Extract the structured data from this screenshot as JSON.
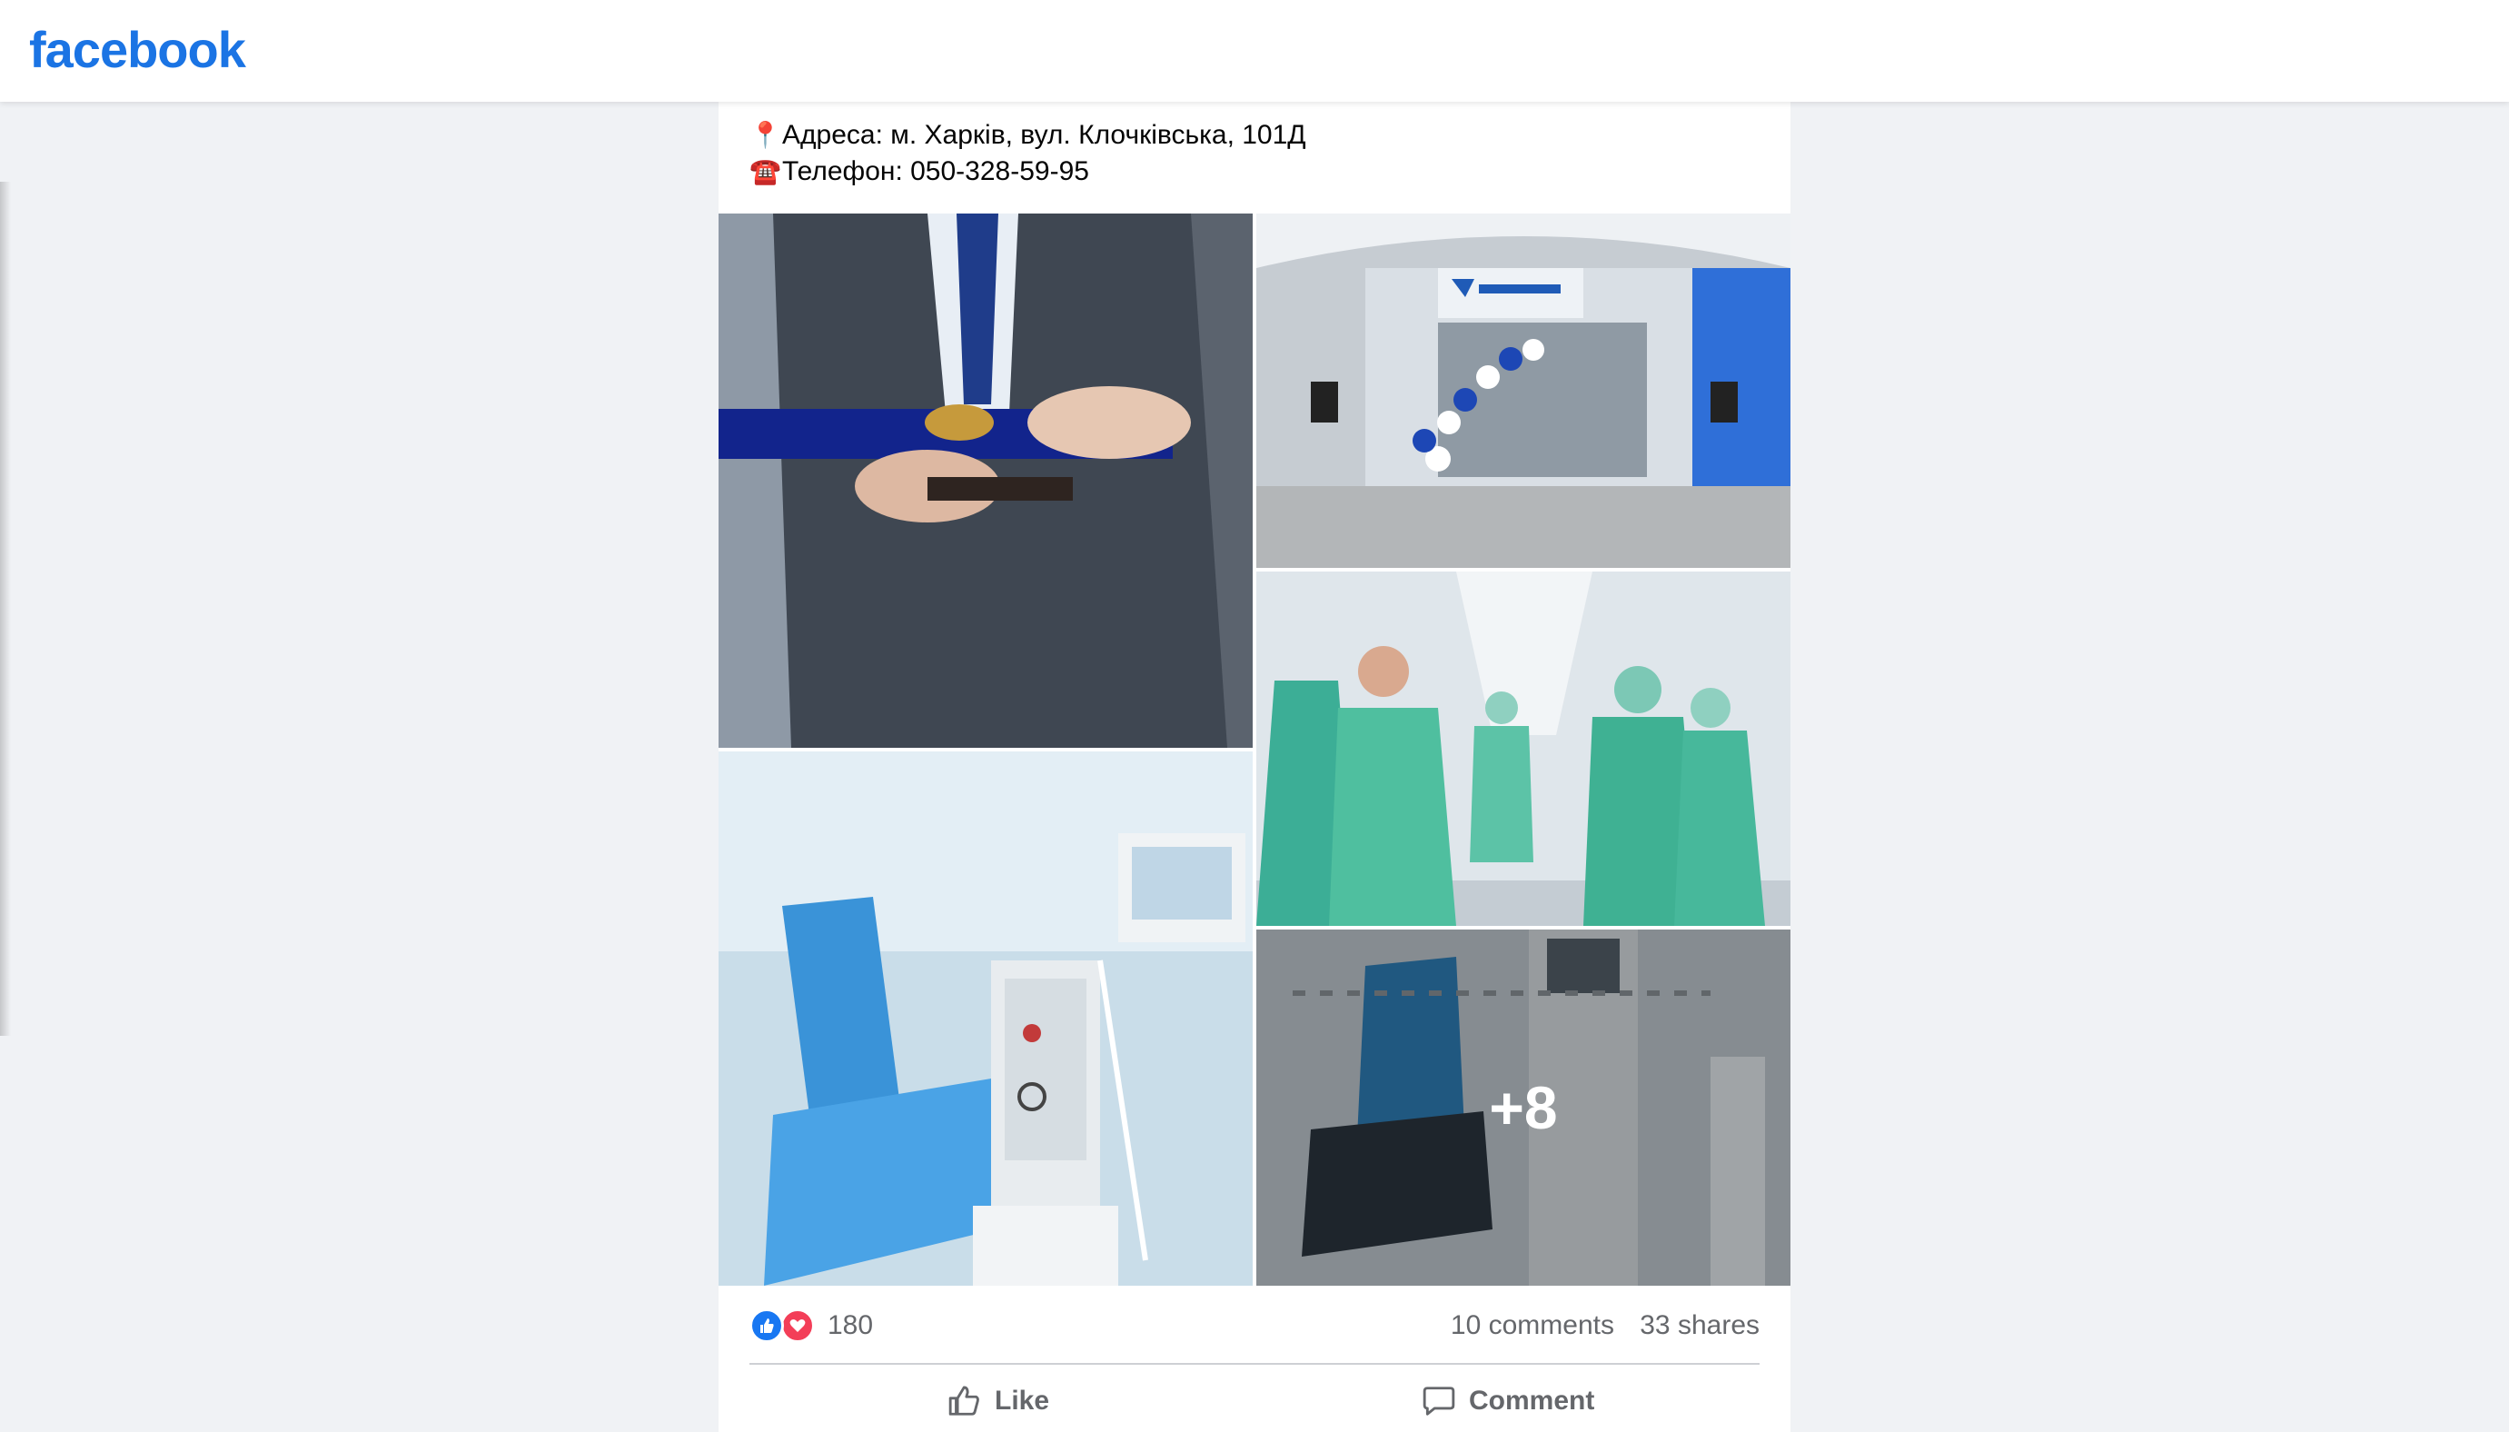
{
  "header": {
    "logo": "facebook"
  },
  "post": {
    "text_lines": [
      {
        "emoji": "📍",
        "text": "Адреса: м. Харків, вул. Клочківська, 101Д"
      },
      {
        "emoji": "☎️",
        "text": "Телефон: 050-328-59-95"
      }
    ],
    "photos": [
      {
        "name": "photo-ribbon-cutting"
      },
      {
        "name": "photo-clinic-entrance"
      },
      {
        "name": "photo-hospital-corridor"
      },
      {
        "name": "photo-dialysis-chair"
      },
      {
        "name": "photo-more",
        "more_label": "+8"
      }
    ],
    "reactions": {
      "count": "180",
      "types": [
        "like",
        "love"
      ]
    },
    "comments_label": "10 comments",
    "shares_label": "33 shares",
    "actions": {
      "like_label": "Like",
      "comment_label": "Comment"
    }
  },
  "colors": {
    "brand": "#1b74e4",
    "like": "#1877f2",
    "love": "#f33e58"
  }
}
